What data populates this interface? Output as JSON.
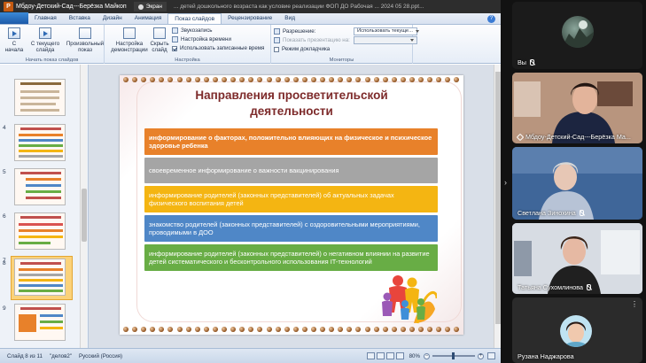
{
  "window": {
    "app_logo": "P",
    "title": "Мбдоу-Детский-Сад---Берёзка Майкоп",
    "share_label": "Экран",
    "doc_title": "... детей дошкольного возраста как условие реализации ФОП ДО Рабочая ... 2024 05 28.ppt..."
  },
  "ribbon_tabs": [
    "Главная",
    "Вставка",
    "Дизайн",
    "Анимация",
    "Показ слайдов",
    "Рецензирование",
    "Вид"
  ],
  "help_label": "?",
  "ribbon": {
    "from_start": "С начала",
    "from_current": "С текущего слайда",
    "custom_show": "Произвольный показ",
    "start_group": "Начать показ слайдов",
    "setup_show": "Настройка демонстрации",
    "hide_slide": "Скрыть слайд",
    "record_narration": "Звукозапись",
    "rehearse_timings": "Настройка времени",
    "use_timings": "Использовать записанные время",
    "setup_group": "Настройка",
    "resolution_label": "Разрешение:",
    "resolution_value": "Использовать текуще...",
    "show_on_label": "Показать презентацию на:",
    "presenter_view": "Режим докладчика",
    "monitors_group": "Мониторы"
  },
  "thumbnails": [
    {
      "num": "4",
      "selected": false
    },
    {
      "num": "5",
      "selected": false
    },
    {
      "num": "6",
      "selected": false
    },
    {
      "num": "7",
      "selected": false
    },
    {
      "num": "8",
      "selected": true
    },
    {
      "num": "9",
      "selected": false
    }
  ],
  "slide": {
    "title_line1": "Направления просветительской",
    "title_line2": "деятельности",
    "items": [
      "информирование о факторах, положительно влияющих на физическое и психическое здоровье ребенка",
      "своевременное информирование о важности вакцинирования",
      "информирование родителей (законных представителей) об актуальных задачах физического воспитания детей",
      "знакомство родителей (законных представителей) с оздоровительными мероприятиями, проводимыми в ДОО",
      "информирование родителей (законных представителей) о негативном влиянии на развитие детей систематического и бесконтрольного использования IT-технологий"
    ],
    "colors": [
      "#e8812a",
      "#a5a5a5",
      "#f4b512",
      "#4f87c7",
      "#68ad45"
    ]
  },
  "status": {
    "slide_info": "Слайд 8 из 11",
    "theme": "\"делов2\"",
    "language": "Русский (Россия)",
    "zoom": "80%"
  },
  "participants": [
    {
      "name": "Вы"
    },
    {
      "name": "Мбдоу-Детский-Сад---Берёзка Ма..."
    },
    {
      "name": "Светлана Зинохина"
    },
    {
      "name": "Татьяна Сухомлинова"
    },
    {
      "name": "Рузана Наджарова"
    }
  ]
}
